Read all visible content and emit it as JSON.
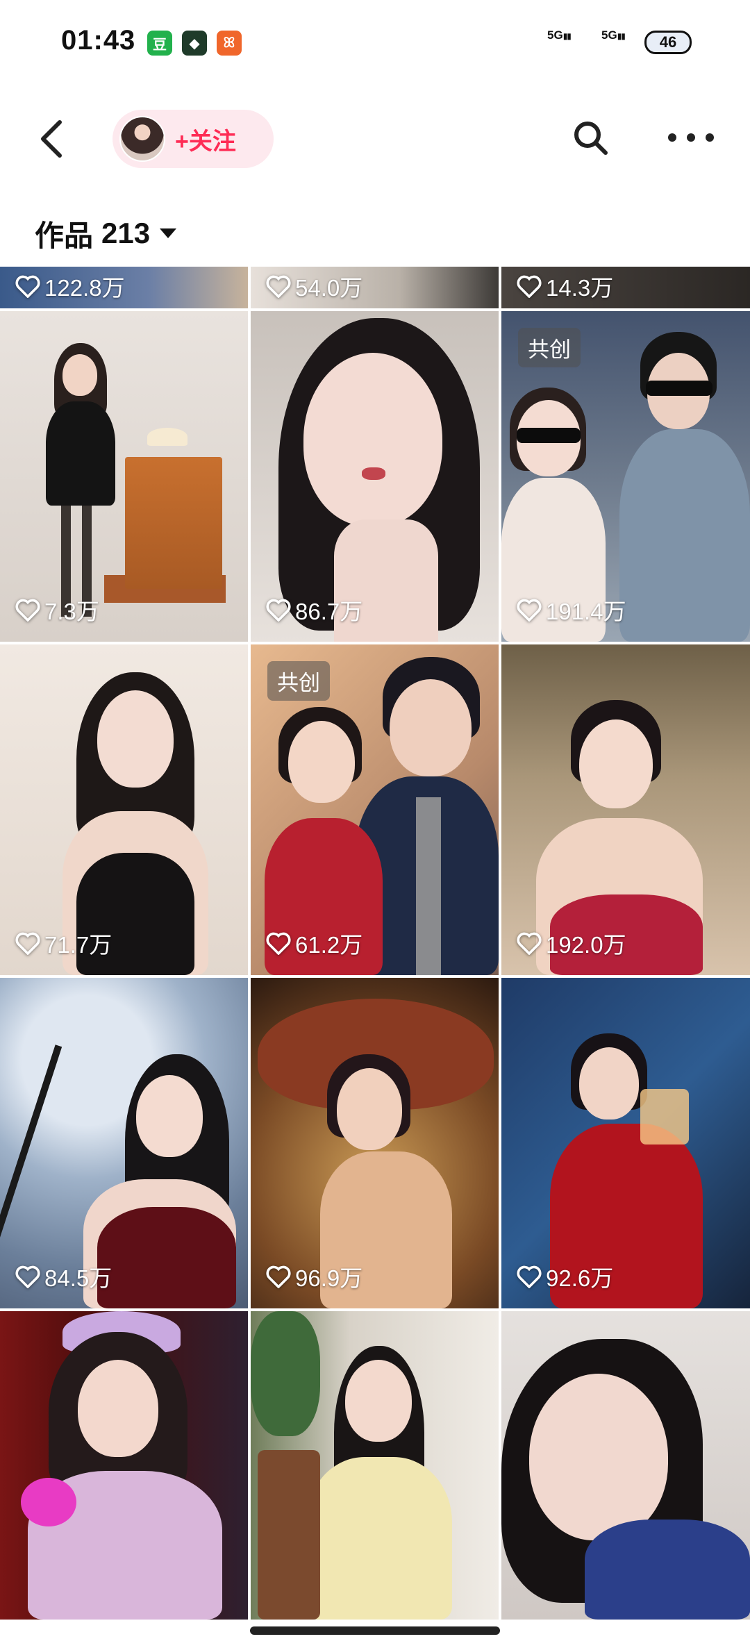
{
  "status_bar": {
    "time": "01:43",
    "apps": [
      "豆",
      "◆",
      "ꕤ"
    ],
    "network1": "5G",
    "network2": "5G",
    "battery": "46"
  },
  "header": {
    "follow_label": "+关注",
    "back_icon": "chevron-left-icon",
    "search_icon": "search-icon",
    "more_icon": "more-horizontal-icon"
  },
  "works_tab": {
    "label": "作品",
    "count": "213"
  },
  "top_partial_row": [
    {
      "likes": "122.8万"
    },
    {
      "likes": "54.0万"
    },
    {
      "likes": "14.3万"
    }
  ],
  "videos": [
    {
      "likes": "7.3万",
      "badge": ""
    },
    {
      "likes": "86.7万",
      "badge": ""
    },
    {
      "likes": "191.4万",
      "badge": "共创"
    },
    {
      "likes": "71.7万",
      "badge": ""
    },
    {
      "likes": "61.2万",
      "badge": "共创"
    },
    {
      "likes": "192.0万",
      "badge": ""
    },
    {
      "likes": "84.5万",
      "badge": ""
    },
    {
      "likes": "96.9万",
      "badge": ""
    },
    {
      "likes": "92.6万",
      "badge": ""
    }
  ],
  "bottom_partial_row": [
    {
      "likes": ""
    },
    {
      "likes": ""
    },
    {
      "likes": ""
    }
  ],
  "colors": {
    "accent": "#fe2c55",
    "follow_bg": "#fde9ee"
  }
}
